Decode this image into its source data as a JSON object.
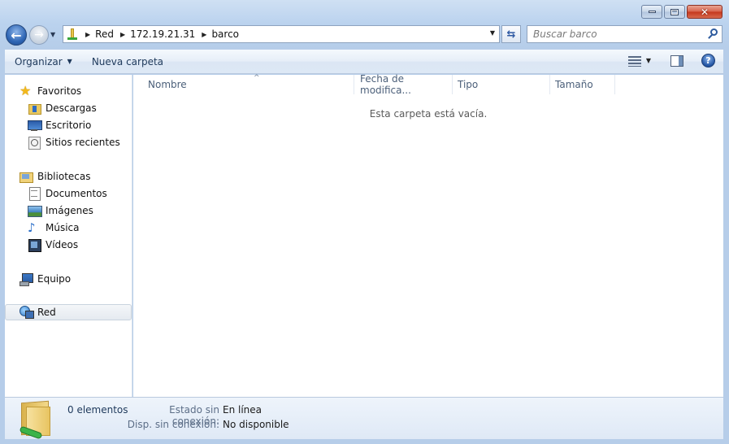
{
  "window": {
    "caption": {
      "minimize_icon": "minimize-icon",
      "maximize_icon": "maximize-icon",
      "close_icon": "close-icon"
    }
  },
  "navigation": {
    "address_crumbs": [
      "Red",
      "172.19.21.31",
      "barco"
    ],
    "search_placeholder": "Buscar barco"
  },
  "toolbar": {
    "organize_label": "Organizar",
    "new_folder_label": "Nueva carpeta"
  },
  "sidebar": {
    "favorites": {
      "label": "Favoritos",
      "items": [
        {
          "label": "Descargas",
          "icon": "downloads-folder-icon"
        },
        {
          "label": "Escritorio",
          "icon": "desktop-icon"
        },
        {
          "label": "Sitios recientes",
          "icon": "recent-places-icon"
        }
      ]
    },
    "libraries": {
      "label": "Bibliotecas",
      "items": [
        {
          "label": "Documentos",
          "icon": "documents-icon"
        },
        {
          "label": "Imágenes",
          "icon": "pictures-icon"
        },
        {
          "label": "Música",
          "icon": "music-icon"
        },
        {
          "label": "Vídeos",
          "icon": "videos-icon"
        }
      ]
    },
    "computer": {
      "label": "Equipo"
    },
    "network": {
      "label": "Red",
      "selected": true
    }
  },
  "file_list": {
    "columns": [
      "Nombre",
      "Fecha de modifica...",
      "Tipo",
      "Tamaño"
    ],
    "empty_message": "Esta carpeta está vacía."
  },
  "details": {
    "item_count": "0 elementos",
    "offline_status_label": "Estado sin conexión:",
    "offline_status_value": "En línea",
    "offline_availability_label": "Disp. sin conexión:",
    "offline_availability_value": "No disponible"
  }
}
